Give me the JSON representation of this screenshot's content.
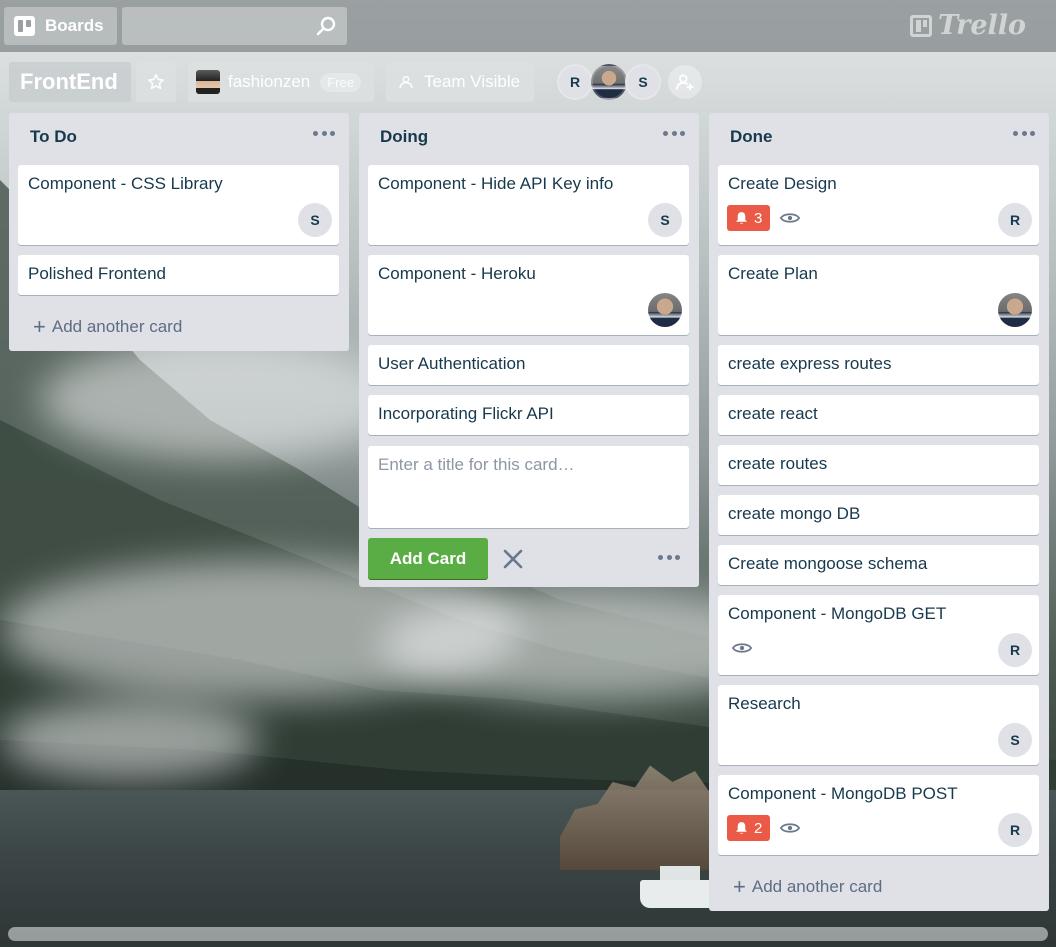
{
  "app": {
    "boards_label": "Boards",
    "search_value": "",
    "logo_text": "Trello"
  },
  "board": {
    "title": "FrontEnd",
    "team_name": "fashionzen",
    "team_plan": "Free",
    "visibility": "Team Visible",
    "members": [
      "R",
      "photo",
      "S"
    ]
  },
  "lists": [
    {
      "name": "To Do",
      "cards": [
        {
          "title": "Component - CSS Library",
          "member": "S"
        },
        {
          "title": "Polished Frontend"
        }
      ],
      "add_label": "Add another card"
    },
    {
      "name": "Doing",
      "cards": [
        {
          "title": "Component - Hide API Key info",
          "member": "S"
        },
        {
          "title": "Component - Heroku",
          "member": "photo"
        },
        {
          "title": "User Authentication"
        },
        {
          "title": "Incorporating Flickr API"
        }
      ],
      "composer": {
        "placeholder": "Enter a title for this card…",
        "value": "",
        "submit_label": "Add Card"
      }
    },
    {
      "name": "Done",
      "cards": [
        {
          "title": "Create Design",
          "due_badge": "3",
          "watch": true,
          "member": "R"
        },
        {
          "title": "Create Plan",
          "member": "photo"
        },
        {
          "title": "create express routes"
        },
        {
          "title": "create react"
        },
        {
          "title": "create routes"
        },
        {
          "title": "create mongo DB"
        },
        {
          "title": "Create mongoose schema"
        },
        {
          "title": "Component - MongoDB GET",
          "watch": true,
          "member": "R"
        },
        {
          "title": "Research",
          "member": "S"
        },
        {
          "title": "Component - MongoDB POST",
          "due_badge": "2",
          "watch": true,
          "member": "R"
        }
      ],
      "add_label": "Add another card"
    }
  ],
  "colors": {
    "list_bg": "#dfe1e6",
    "card_bg": "#ffffff",
    "add_card_green": "#5aac44",
    "due_badge_red": "#eb5a46",
    "text": "#17394d"
  }
}
